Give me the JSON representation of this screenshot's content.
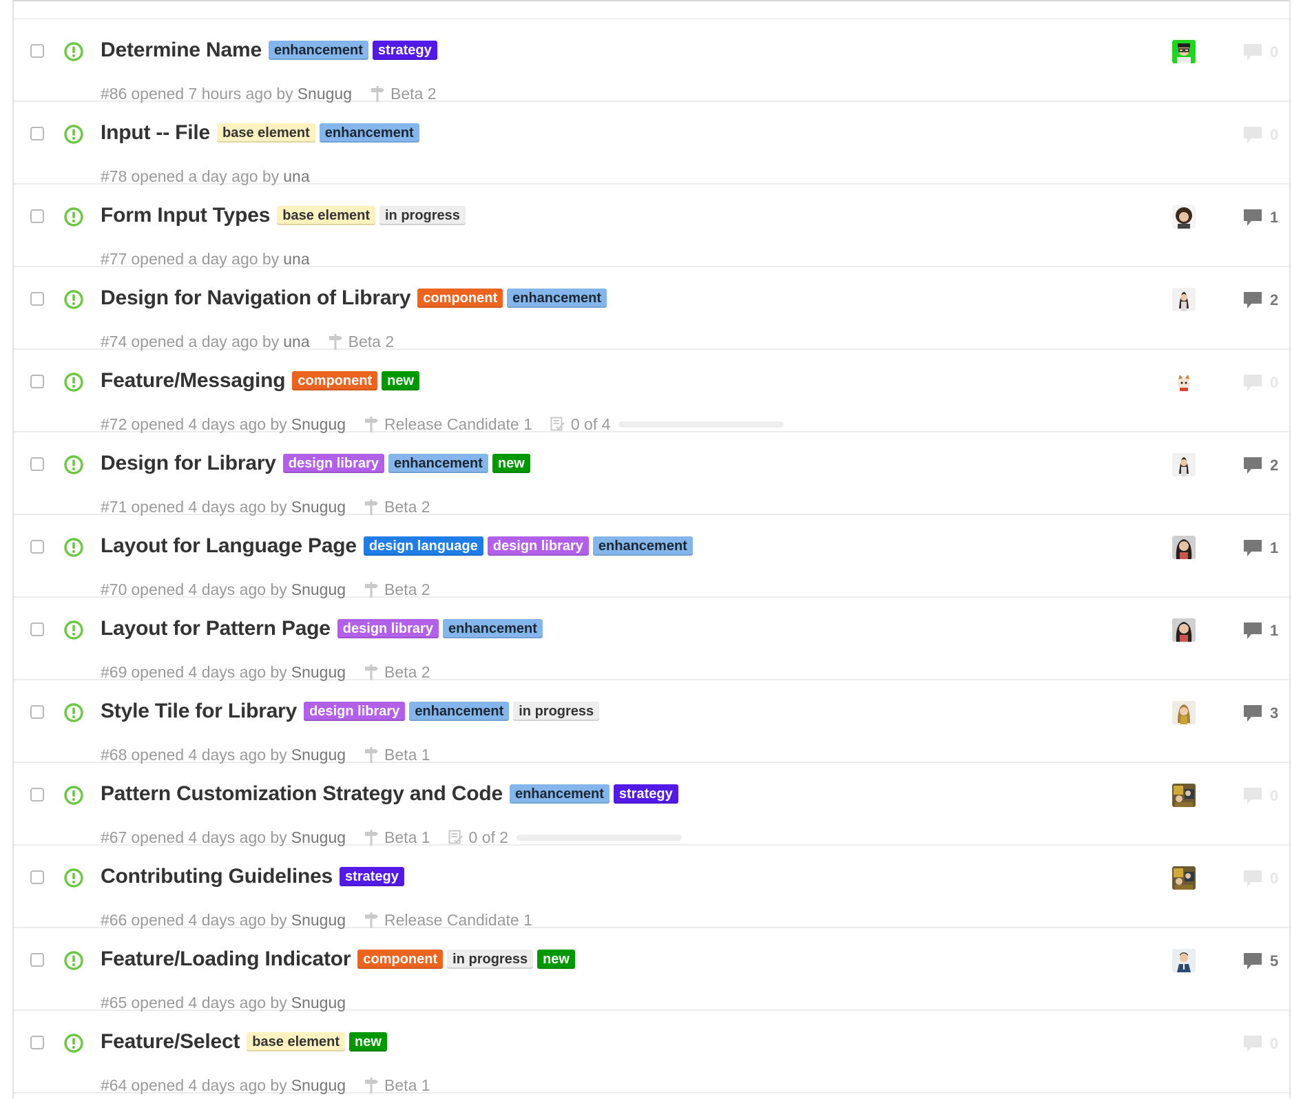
{
  "colors": {
    "open_icon": "#6cc644",
    "label_enhancement_bg": "#84b6eb",
    "label_enhancement_fg": "#1c2733",
    "label_strategy_bg": "#5319e7",
    "label_base_element_bg": "#fef2c0",
    "label_in_progress_bg": "#ededed",
    "label_component_bg": "#eb6420",
    "label_new_bg": "#009800",
    "label_design_library_bg": "#b260e8",
    "label_design_language_bg": "#207de5",
    "comment_active": "#777777",
    "comment_zero": "#e6e6e6"
  },
  "issues": [
    {
      "title": "Determine Name",
      "labels": [
        {
          "text": "enhancement",
          "bg": "#84b6eb",
          "fg": "#1c2733"
        },
        {
          "text": "strategy",
          "bg": "#5319e7",
          "fg": "#ffffff"
        }
      ],
      "number": "#86",
      "opened": "opened 7 hours ago by",
      "author": "Snugug",
      "milestone": "Beta 2",
      "tasks": "",
      "tasks_progress": null,
      "avatar": "avatar-green",
      "comments": "0",
      "comments_zero": true
    },
    {
      "title": "Input -- File",
      "labels": [
        {
          "text": "base element",
          "bg": "#fef2c0",
          "fg": "#333333"
        },
        {
          "text": "enhancement",
          "bg": "#84b6eb",
          "fg": "#1c2733"
        }
      ],
      "number": "#78",
      "opened": "opened a day ago by",
      "author": "una",
      "milestone": "",
      "tasks": "",
      "tasks_progress": null,
      "avatar": "",
      "comments": "0",
      "comments_zero": true
    },
    {
      "title": "Form Input Types",
      "labels": [
        {
          "text": "base element",
          "bg": "#fef2c0",
          "fg": "#333333"
        },
        {
          "text": "in progress",
          "bg": "#ededed",
          "fg": "#333333"
        }
      ],
      "number": "#77",
      "opened": "opened a day ago by",
      "author": "una",
      "milestone": "",
      "tasks": "",
      "tasks_progress": null,
      "avatar": "avatar-curly",
      "comments": "1",
      "comments_zero": false
    },
    {
      "title": "Design for Navigation of Library",
      "labels": [
        {
          "text": "component",
          "bg": "#eb6420",
          "fg": "#ffffff"
        },
        {
          "text": "enhancement",
          "bg": "#84b6eb",
          "fg": "#1c2733"
        }
      ],
      "number": "#74",
      "opened": "opened a day ago by",
      "author": "una",
      "milestone": "Beta 2",
      "tasks": "",
      "tasks_progress": null,
      "avatar": "avatar-woman",
      "comments": "2",
      "comments_zero": false
    },
    {
      "title": "Feature/Messaging",
      "labels": [
        {
          "text": "component",
          "bg": "#eb6420",
          "fg": "#ffffff"
        },
        {
          "text": "new",
          "bg": "#009800",
          "fg": "#ffffff"
        }
      ],
      "number": "#72",
      "opened": "opened 4 days ago by",
      "author": "Snugug",
      "milestone": "Release Candidate 1",
      "tasks": "0 of 4",
      "tasks_progress": 0,
      "avatar": "avatar-cat",
      "comments": "0",
      "comments_zero": true
    },
    {
      "title": "Design for Library",
      "labels": [
        {
          "text": "design library",
          "bg": "#b260e8",
          "fg": "#ffffff"
        },
        {
          "text": "enhancement",
          "bg": "#84b6eb",
          "fg": "#1c2733"
        },
        {
          "text": "new",
          "bg": "#009800",
          "fg": "#ffffff"
        }
      ],
      "number": "#71",
      "opened": "opened 4 days ago by",
      "author": "Snugug",
      "milestone": "Beta 2",
      "tasks": "",
      "tasks_progress": null,
      "avatar": "avatar-woman",
      "comments": "2",
      "comments_zero": false
    },
    {
      "title": "Layout for Language Page",
      "labels": [
        {
          "text": "design language",
          "bg": "#207de5",
          "fg": "#ffffff"
        },
        {
          "text": "design library",
          "bg": "#b260e8",
          "fg": "#ffffff"
        },
        {
          "text": "enhancement",
          "bg": "#84b6eb",
          "fg": "#1c2733"
        }
      ],
      "number": "#70",
      "opened": "opened 4 days ago by",
      "author": "Snugug",
      "milestone": "Beta 2",
      "tasks": "",
      "tasks_progress": null,
      "avatar": "avatar-dark",
      "comments": "1",
      "comments_zero": false
    },
    {
      "title": "Layout for Pattern Page",
      "labels": [
        {
          "text": "design library",
          "bg": "#b260e8",
          "fg": "#ffffff"
        },
        {
          "text": "enhancement",
          "bg": "#84b6eb",
          "fg": "#1c2733"
        }
      ],
      "number": "#69",
      "opened": "opened 4 days ago by",
      "author": "Snugug",
      "milestone": "Beta 2",
      "tasks": "",
      "tasks_progress": null,
      "avatar": "avatar-dark",
      "comments": "1",
      "comments_zero": false
    },
    {
      "title": "Style Tile for Library",
      "labels": [
        {
          "text": "design library",
          "bg": "#b260e8",
          "fg": "#ffffff"
        },
        {
          "text": "enhancement",
          "bg": "#84b6eb",
          "fg": "#1c2733"
        },
        {
          "text": "in progress",
          "bg": "#ededed",
          "fg": "#333333"
        }
      ],
      "number": "#68",
      "opened": "opened 4 days ago by",
      "author": "Snugug",
      "milestone": "Beta 1",
      "tasks": "",
      "tasks_progress": null,
      "avatar": "avatar-blonde",
      "comments": "3",
      "comments_zero": false
    },
    {
      "title": "Pattern Customization Strategy and Code",
      "labels": [
        {
          "text": "enhancement",
          "bg": "#84b6eb",
          "fg": "#1c2733"
        },
        {
          "text": "strategy",
          "bg": "#5319e7",
          "fg": "#ffffff"
        }
      ],
      "number": "#67",
      "opened": "opened 4 days ago by",
      "author": "Snugug",
      "milestone": "Beta 1",
      "tasks": "0 of 2",
      "tasks_progress": 0,
      "avatar": "avatar-group",
      "comments": "0",
      "comments_zero": true
    },
    {
      "title": "Contributing Guidelines",
      "labels": [
        {
          "text": "strategy",
          "bg": "#5319e7",
          "fg": "#ffffff"
        }
      ],
      "number": "#66",
      "opened": "opened 4 days ago by",
      "author": "Snugug",
      "milestone": "Release Candidate 1",
      "tasks": "",
      "tasks_progress": null,
      "avatar": "avatar-group",
      "comments": "0",
      "comments_zero": true
    },
    {
      "title": "Feature/Loading Indicator",
      "labels": [
        {
          "text": "component",
          "bg": "#eb6420",
          "fg": "#ffffff"
        },
        {
          "text": "in progress",
          "bg": "#ededed",
          "fg": "#333333"
        },
        {
          "text": "new",
          "bg": "#009800",
          "fg": "#ffffff"
        }
      ],
      "number": "#65",
      "opened": "opened 4 days ago by",
      "author": "Snugug",
      "milestone": "",
      "tasks": "",
      "tasks_progress": null,
      "avatar": "avatar-man",
      "comments": "5",
      "comments_zero": false
    },
    {
      "title": "Feature/Select",
      "labels": [
        {
          "text": "base element",
          "bg": "#fef2c0",
          "fg": "#333333"
        },
        {
          "text": "new",
          "bg": "#009800",
          "fg": "#ffffff"
        }
      ],
      "number": "#64",
      "opened": "opened 4 days ago by",
      "author": "Snugug",
      "milestone": "Beta 1",
      "tasks": "",
      "tasks_progress": null,
      "avatar": "",
      "comments": "0",
      "comments_zero": true
    }
  ]
}
